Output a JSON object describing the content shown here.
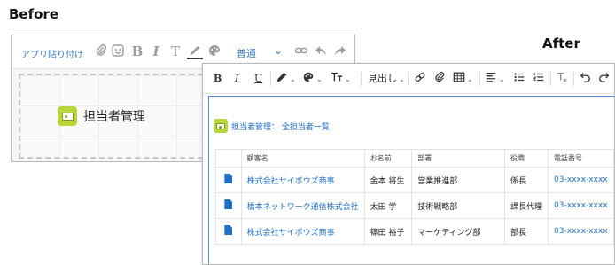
{
  "labels": {
    "before": "Before",
    "after": "After"
  },
  "before": {
    "toolbar": {
      "paste_app": "アプリ貼り付け",
      "font": "普通"
    },
    "title": "担当者管理"
  },
  "after": {
    "toolbar": {
      "heading": "見出し"
    },
    "subtitle": "担当者管理： 全担当者一覧",
    "table": {
      "headers": [
        "",
        "顧客名",
        "お名前",
        "部署",
        "役職",
        "電話番号"
      ],
      "rows": [
        [
          "",
          "株式会社サイボウズ商事",
          "金本 将生",
          "営業推進部",
          "係長",
          "03-xxxx-xxxx"
        ],
        [
          "",
          "橋本ネットワーク通信株式会社",
          "太田 学",
          "技術戦略部",
          "課長代理",
          "03-xxxx-xxxx"
        ],
        [
          "",
          "株式会社サイボウズ商事",
          "篠田 裕子",
          "マーケティング部",
          "部長",
          "03-xxxx-xxxx"
        ]
      ]
    }
  },
  "colors": {
    "link": "#1f6fc6",
    "accent_border": "#4a8fe0",
    "app_icon": "#b8d63c"
  }
}
